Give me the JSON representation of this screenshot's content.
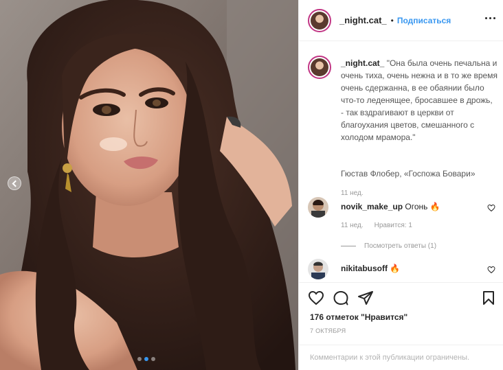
{
  "post": {
    "username": "_night.cat_",
    "separator": "•",
    "follow_label": "Подписаться"
  },
  "caption": {
    "username": "_night.cat_",
    "text": "\"Она была очень печальна и очень тиха, очень нежна и в то же время очень сдержанна, в ее обаянии было что-то леденящее, бросавшее в дрожь, - так вздрагивают в церкви от благоухания цветов, смешанного с холодом мрамора.\"",
    "signature": "Гюстав Флобер, «Госпожа Бовари»",
    "time": "11 нед."
  },
  "comments": [
    {
      "username": "novik_make_up",
      "text": "Огонь 🔥",
      "time": "11 нед.",
      "likes": "Нравится: 1",
      "replies_label": "Посмотреть ответы (1)"
    },
    {
      "username": "nikitabusoff",
      "text": "🔥"
    }
  ],
  "footer": {
    "likes_label": "176 отметок \"Нравится\"",
    "date": "7 ОКТЯБРЯ",
    "comments_disabled": "Комментарии к этой публикации ограничены."
  },
  "carousel": {
    "slide_count": 3,
    "active_index": 1
  },
  "icons": [
    "more-icon",
    "heart-icon",
    "comment-icon",
    "share-icon",
    "bookmark-icon",
    "chevron-left-icon"
  ],
  "colors": {
    "accent": "#3897f0",
    "text": "#262626",
    "muted": "#999999",
    "border": "#efefef",
    "fire": "#f77d1e"
  }
}
